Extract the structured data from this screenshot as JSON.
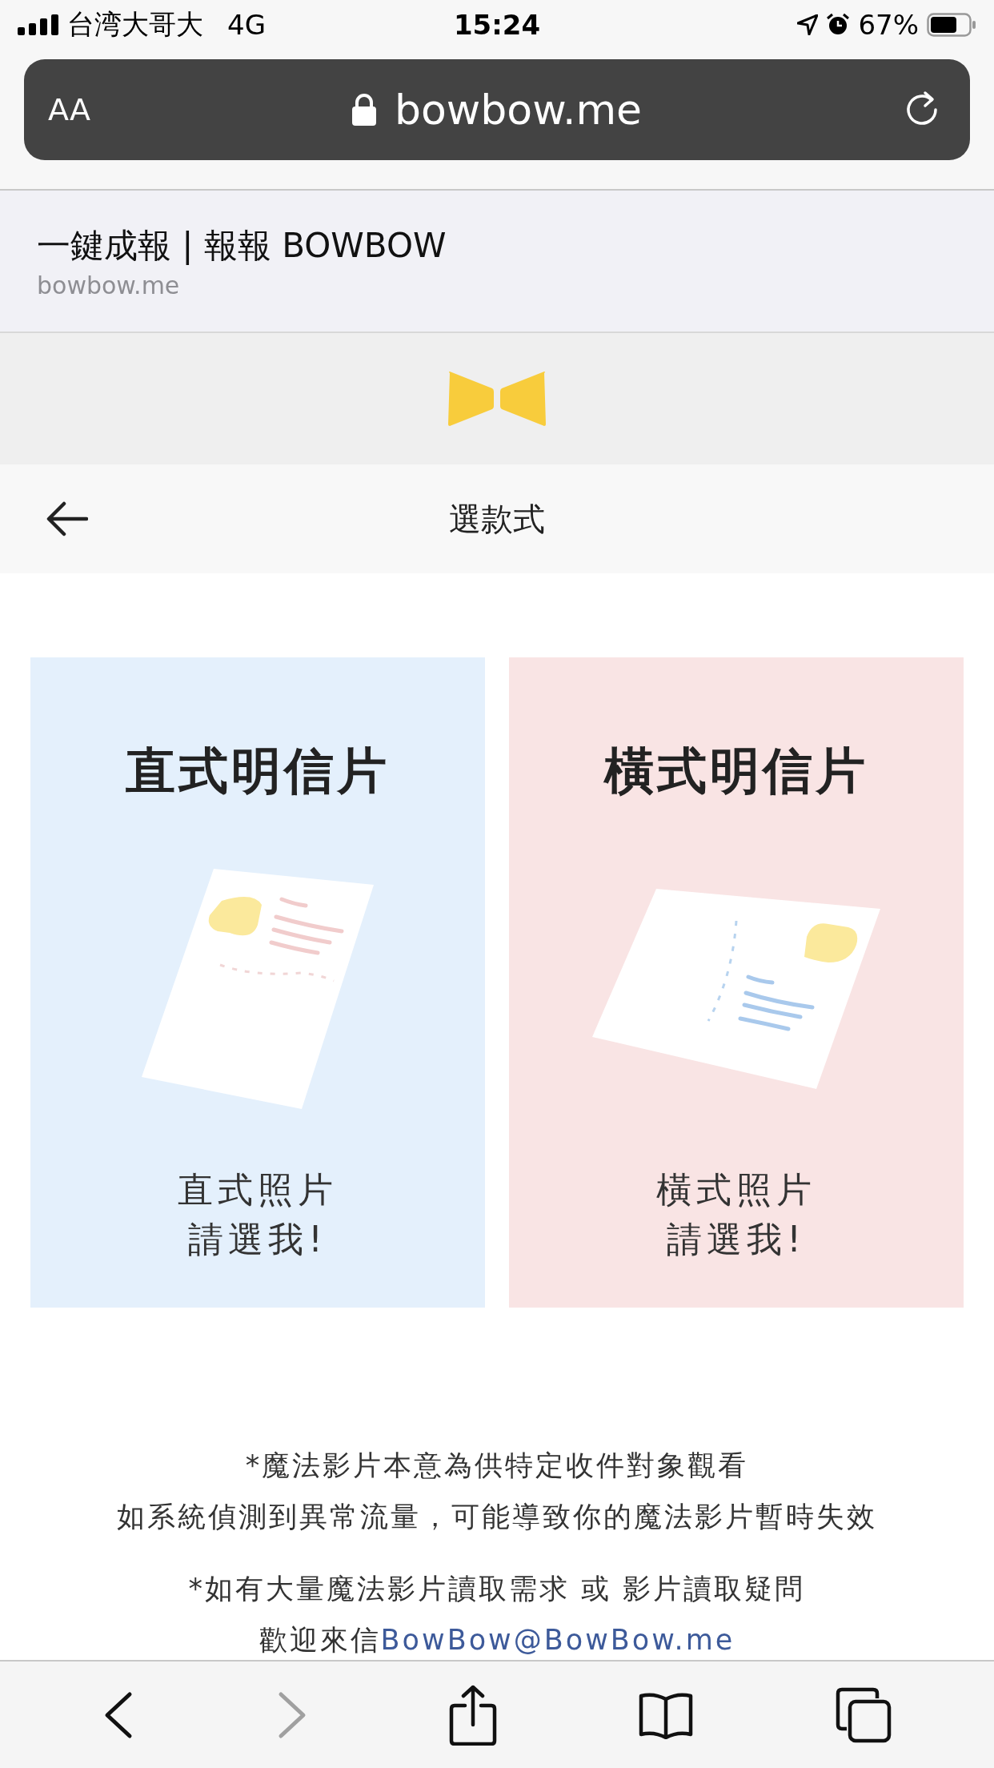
{
  "status_bar": {
    "carrier": "台湾大哥大",
    "network": "4G",
    "time": "15:24",
    "battery": "67%"
  },
  "browser": {
    "text_size_button": "AA",
    "url": "bowbow.me"
  },
  "page_header": {
    "title": "一鍵成報 | 報報 BOWBOW",
    "domain": "bowbow.me"
  },
  "nav": {
    "title": "選款式"
  },
  "cards": [
    {
      "title": "直式明信片",
      "kind": "portrait",
      "color": "#e4f0fc",
      "caption": [
        "直式照片",
        "請選我!"
      ]
    },
    {
      "title": "橫式明信片",
      "kind": "landscape",
      "color": "#f9e4e4",
      "caption": [
        "橫式照片",
        "請選我!"
      ]
    }
  ],
  "notes": [
    {
      "lines": [
        {
          "text": "*魔法影片本意為供特定收件對象觀看"
        },
        {
          "text": "如系統偵測到異常流量，可能導致你的魔法影片暫時失效"
        }
      ]
    },
    {
      "lines": [
        {
          "text": "*如有大量魔法影片讀取需求 或 影片讀取疑問"
        },
        {
          "text": "歡迎來信",
          "link": "BowBow@BowBow.me"
        }
      ]
    }
  ],
  "toolbar": [
    {
      "kind": "back",
      "disabled": false
    },
    {
      "kind": "forward",
      "disabled": true
    },
    {
      "kind": "share",
      "disabled": false
    },
    {
      "kind": "bookmarks",
      "disabled": false
    },
    {
      "kind": "tabs",
      "disabled": false
    }
  ]
}
